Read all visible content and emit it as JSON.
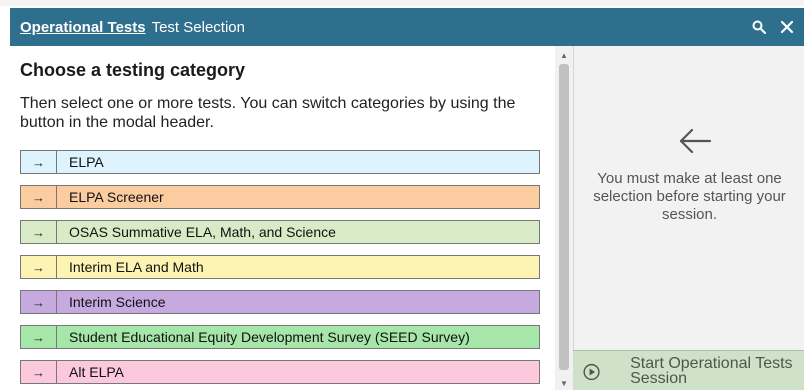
{
  "header": {
    "title": "Operational Tests",
    "subtitle": "Test Selection",
    "search_icon": "search-icon",
    "close_icon": "close-icon",
    "bg": "#2f6f8e"
  },
  "main": {
    "heading": "Choose a testing category",
    "intro": "Then select one or more tests. You can switch categories by using the button in the modal header.",
    "categories": [
      {
        "label": "ELPA",
        "color": "#ddf3fd",
        "arrow": "→"
      },
      {
        "label": "ELPA Screener",
        "color": "#fbcc9f",
        "arrow": "→"
      },
      {
        "label": "OSAS Summative ELA, Math, and Science",
        "color": "#d8ebc6",
        "arrow": "→"
      },
      {
        "label": "Interim ELA and Math",
        "color": "#fdf4b4",
        "arrow": "→"
      },
      {
        "label": "Interim Science",
        "color": "#c6a9de",
        "arrow": "→"
      },
      {
        "label": "Student Educational Equity Development Survey (SEED Survey)",
        "color": "#a6e6a8",
        "arrow": "→"
      },
      {
        "label": "Alt ELPA",
        "color": "#fbc8dc",
        "arrow": "→"
      }
    ]
  },
  "side": {
    "arrow_icon": "arrow-left-icon",
    "message": "You must make at least one selection before starting your session.",
    "start_label": "Start Operational Tests Session",
    "start_icon": "play-circle-icon"
  }
}
